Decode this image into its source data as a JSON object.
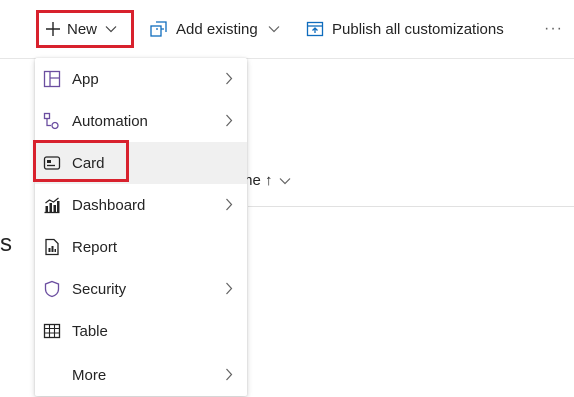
{
  "toolbar": {
    "new_label": "New",
    "add_existing_label": "Add existing",
    "publish_label": "Publish all customizations",
    "more_label": "···"
  },
  "table": {
    "column_header": "me ↑"
  },
  "background_text": "s",
  "menu": {
    "items": [
      {
        "label": "App",
        "icon": "app-icon",
        "submenu": true
      },
      {
        "label": "Automation",
        "icon": "automation-icon",
        "submenu": true
      },
      {
        "label": "Card",
        "icon": "card-icon",
        "submenu": false,
        "highlighted": true
      },
      {
        "label": "Dashboard",
        "icon": "dashboard-icon",
        "submenu": true
      },
      {
        "label": "Report",
        "icon": "report-icon",
        "submenu": false
      },
      {
        "label": "Security",
        "icon": "security-icon",
        "submenu": true
      },
      {
        "label": "Table",
        "icon": "table-icon",
        "submenu": false
      },
      {
        "label": "More",
        "icon": "",
        "submenu": true
      }
    ]
  },
  "colors": {
    "accent": "#0f6cbd",
    "highlight_border": "#d8212d",
    "icon_purple": "#6b4ea0"
  }
}
